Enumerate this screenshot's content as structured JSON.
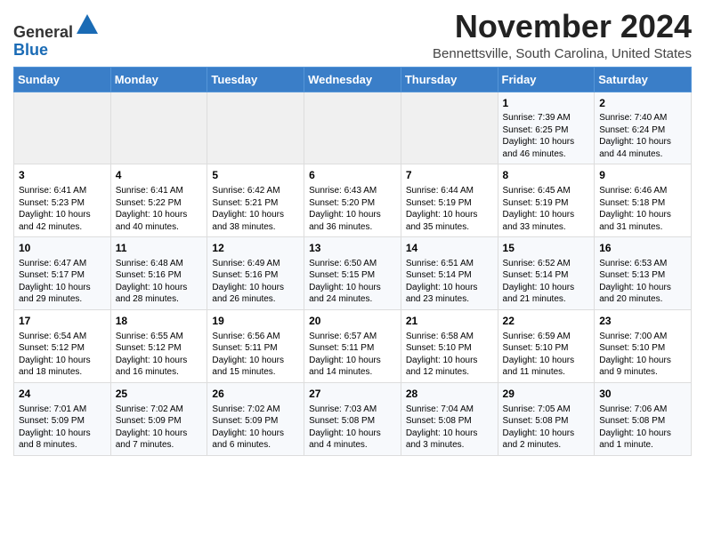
{
  "app": {
    "logo_line1": "General",
    "logo_line2": "Blue"
  },
  "header": {
    "title": "November 2024",
    "location": "Bennettsville, South Carolina, United States"
  },
  "calendar": {
    "weekdays": [
      "Sunday",
      "Monday",
      "Tuesday",
      "Wednesday",
      "Thursday",
      "Friday",
      "Saturday"
    ],
    "weeks": [
      [
        {
          "day": "",
          "info": ""
        },
        {
          "day": "",
          "info": ""
        },
        {
          "day": "",
          "info": ""
        },
        {
          "day": "",
          "info": ""
        },
        {
          "day": "",
          "info": ""
        },
        {
          "day": "1",
          "info": "Sunrise: 7:39 AM\nSunset: 6:25 PM\nDaylight: 10 hours and 46 minutes."
        },
        {
          "day": "2",
          "info": "Sunrise: 7:40 AM\nSunset: 6:24 PM\nDaylight: 10 hours and 44 minutes."
        }
      ],
      [
        {
          "day": "3",
          "info": "Sunrise: 6:41 AM\nSunset: 5:23 PM\nDaylight: 10 hours and 42 minutes."
        },
        {
          "day": "4",
          "info": "Sunrise: 6:41 AM\nSunset: 5:22 PM\nDaylight: 10 hours and 40 minutes."
        },
        {
          "day": "5",
          "info": "Sunrise: 6:42 AM\nSunset: 5:21 PM\nDaylight: 10 hours and 38 minutes."
        },
        {
          "day": "6",
          "info": "Sunrise: 6:43 AM\nSunset: 5:20 PM\nDaylight: 10 hours and 36 minutes."
        },
        {
          "day": "7",
          "info": "Sunrise: 6:44 AM\nSunset: 5:19 PM\nDaylight: 10 hours and 35 minutes."
        },
        {
          "day": "8",
          "info": "Sunrise: 6:45 AM\nSunset: 5:19 PM\nDaylight: 10 hours and 33 minutes."
        },
        {
          "day": "9",
          "info": "Sunrise: 6:46 AM\nSunset: 5:18 PM\nDaylight: 10 hours and 31 minutes."
        }
      ],
      [
        {
          "day": "10",
          "info": "Sunrise: 6:47 AM\nSunset: 5:17 PM\nDaylight: 10 hours and 29 minutes."
        },
        {
          "day": "11",
          "info": "Sunrise: 6:48 AM\nSunset: 5:16 PM\nDaylight: 10 hours and 28 minutes."
        },
        {
          "day": "12",
          "info": "Sunrise: 6:49 AM\nSunset: 5:16 PM\nDaylight: 10 hours and 26 minutes."
        },
        {
          "day": "13",
          "info": "Sunrise: 6:50 AM\nSunset: 5:15 PM\nDaylight: 10 hours and 24 minutes."
        },
        {
          "day": "14",
          "info": "Sunrise: 6:51 AM\nSunset: 5:14 PM\nDaylight: 10 hours and 23 minutes."
        },
        {
          "day": "15",
          "info": "Sunrise: 6:52 AM\nSunset: 5:14 PM\nDaylight: 10 hours and 21 minutes."
        },
        {
          "day": "16",
          "info": "Sunrise: 6:53 AM\nSunset: 5:13 PM\nDaylight: 10 hours and 20 minutes."
        }
      ],
      [
        {
          "day": "17",
          "info": "Sunrise: 6:54 AM\nSunset: 5:12 PM\nDaylight: 10 hours and 18 minutes."
        },
        {
          "day": "18",
          "info": "Sunrise: 6:55 AM\nSunset: 5:12 PM\nDaylight: 10 hours and 16 minutes."
        },
        {
          "day": "19",
          "info": "Sunrise: 6:56 AM\nSunset: 5:11 PM\nDaylight: 10 hours and 15 minutes."
        },
        {
          "day": "20",
          "info": "Sunrise: 6:57 AM\nSunset: 5:11 PM\nDaylight: 10 hours and 14 minutes."
        },
        {
          "day": "21",
          "info": "Sunrise: 6:58 AM\nSunset: 5:10 PM\nDaylight: 10 hours and 12 minutes."
        },
        {
          "day": "22",
          "info": "Sunrise: 6:59 AM\nSunset: 5:10 PM\nDaylight: 10 hours and 11 minutes."
        },
        {
          "day": "23",
          "info": "Sunrise: 7:00 AM\nSunset: 5:10 PM\nDaylight: 10 hours and 9 minutes."
        }
      ],
      [
        {
          "day": "24",
          "info": "Sunrise: 7:01 AM\nSunset: 5:09 PM\nDaylight: 10 hours and 8 minutes."
        },
        {
          "day": "25",
          "info": "Sunrise: 7:02 AM\nSunset: 5:09 PM\nDaylight: 10 hours and 7 minutes."
        },
        {
          "day": "26",
          "info": "Sunrise: 7:02 AM\nSunset: 5:09 PM\nDaylight: 10 hours and 6 minutes."
        },
        {
          "day": "27",
          "info": "Sunrise: 7:03 AM\nSunset: 5:08 PM\nDaylight: 10 hours and 4 minutes."
        },
        {
          "day": "28",
          "info": "Sunrise: 7:04 AM\nSunset: 5:08 PM\nDaylight: 10 hours and 3 minutes."
        },
        {
          "day": "29",
          "info": "Sunrise: 7:05 AM\nSunset: 5:08 PM\nDaylight: 10 hours and 2 minutes."
        },
        {
          "day": "30",
          "info": "Sunrise: 7:06 AM\nSunset: 5:08 PM\nDaylight: 10 hours and 1 minute."
        }
      ]
    ]
  }
}
